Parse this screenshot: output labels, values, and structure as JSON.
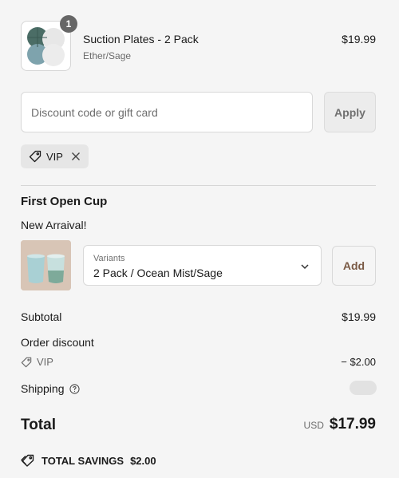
{
  "line_item": {
    "quantity": "1",
    "title": "Suction Plates - 2 Pack",
    "variant": "Ether/Sage",
    "price": "$19.99"
  },
  "discount": {
    "placeholder": "Discount code or gift card",
    "value": "",
    "apply_label": "Apply",
    "applied_code": "VIP"
  },
  "upsell": {
    "title": "First Open Cup",
    "subtitle": "New Arraival!",
    "variants_label": "Variants",
    "selected_variant": "2 Pack / Ocean Mist/Sage",
    "add_label": "Add"
  },
  "summary": {
    "subtotal_label": "Subtotal",
    "subtotal_value": "$19.99",
    "order_discount_label": "Order discount",
    "discount_code": "VIP",
    "discount_value": "− $2.00",
    "shipping_label": "Shipping",
    "total_label": "Total",
    "currency": "USD",
    "total_value": "$17.99",
    "savings_label": "TOTAL SAVINGS",
    "savings_value": "$2.00"
  },
  "colors": {
    "background": "#f5f5f5",
    "add_button_text": "#7a5a45",
    "badge": "#666666"
  },
  "icons": [
    "tag-icon",
    "close-icon",
    "chevron-down-icon",
    "help-circle-icon",
    "savings-tag-icon"
  ]
}
